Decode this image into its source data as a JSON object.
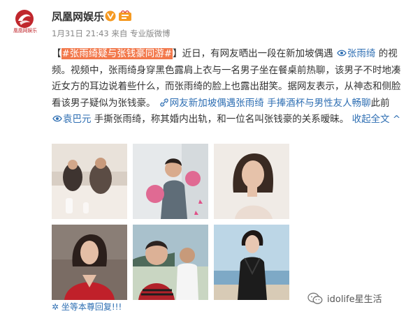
{
  "account": {
    "name": "凤凰网娱乐",
    "avatar_caption": "凰凰网娱乐",
    "post_meta": "1月31日 21:43 来自 专业版微博"
  },
  "post": {
    "topic": "#张雨绮疑与张钱豪同游#",
    "bracket_open": "【",
    "bracket_close": "】",
    "text_1": "近日，有网友晒出一段在新加坡偶遇",
    "mention_1": "张雨绮",
    "text_2": "的视频。视频中，张雨绮身穿黑色露肩上衣与一名男子坐在餐桌前热聊，该男子不时地凑近女方的耳边说着些什么，而张雨绮的脸上也露出甜笑。据网友表示，从神态和侧脸看该男子疑似为张钱豪。",
    "link_1": "网友新加坡偶遇张雨绮 手捧酒杯与男性友人畅聊",
    "text_3": "此前",
    "mention_2": "袁巴元",
    "text_4": "手撕张雨绮，称其婚内出轨，和一位名叫张钱豪的关系暧昧。",
    "collapse_label": "收起全文",
    "collapse_arrow": "^"
  },
  "photos": [
    {
      "name": "restaurant-photo",
      "palette": [
        "#d9cfc6",
        "#7a6c62"
      ]
    },
    {
      "name": "boxing-photo",
      "palette": [
        "#e4e8ea",
        "#c8a890"
      ]
    },
    {
      "name": "portrait-photo-white",
      "palette": [
        "#f1ece7",
        "#3a2a22"
      ]
    },
    {
      "name": "red-dress-photo",
      "palette": [
        "#7d6e66",
        "#c0202a"
      ]
    },
    {
      "name": "beach-selfie-photo",
      "palette": [
        "#9fb8c4",
        "#5c6f74"
      ]
    },
    {
      "name": "seaside-black-dress-photo",
      "palette": [
        "#b9d3e4",
        "#1f1f1f"
      ]
    }
  ],
  "footer": {
    "repost_text": "✲ 坐等本尊回复!!!",
    "watermark": "idolife星生活"
  },
  "colors": {
    "topic_highlight": "#f2784b",
    "link_blue": "#2f6fb3",
    "verified_orange": "#f59a23",
    "brand_red": "#c0272d"
  }
}
